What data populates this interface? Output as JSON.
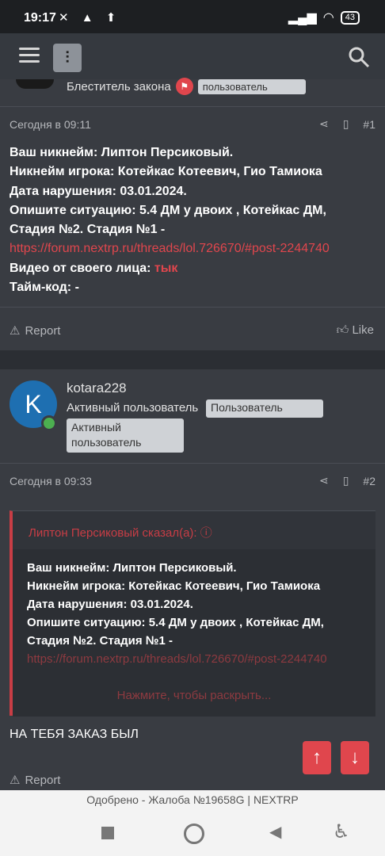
{
  "status": {
    "time": "19:17",
    "battery": "43"
  },
  "top_user": {
    "title": "Блеститель закона",
    "badge": "пользователь"
  },
  "post1": {
    "date": "Сегодня в 09:11",
    "number": "#1",
    "lines": [
      "Ваш никнейм: Липтон Персиковый.",
      "Никнейм игрока: Котейкас Котеевич, Гио Тамиока",
      "Дата нарушения: 03.01.2024.",
      "Опишите ситуацию: 5.4 ДМ у двоих , Котейкас ДМ,",
      "Стадия №2. Стадия №1 -"
    ],
    "link": "https://forum.nextrp.ru/threads/lol.726670/#post-2244740",
    "video_label": "Видео от своего лица: ",
    "video_link": "тык",
    "timecode": "Тайм-код: -",
    "report": "Report",
    "like": "Like"
  },
  "post2": {
    "avatar_letter": "K",
    "username": "kotara228",
    "user_title": "Активный пользователь",
    "badge1": "Пользователь",
    "badge2": "Активный пользователь",
    "date": "Сегодня в 09:33",
    "number": "#2",
    "quote_header": "Липтон Персиковый сказал(а):",
    "quote_lines": [
      "Ваш никнейм: Липтон Персиковый.",
      "Никнейм игрока: Котейкас Котеевич, Гио Тамиока",
      "Дата нарушения: 03.01.2024.",
      "Опишите ситуацию: 5.4 ДМ у двоих , Котейкас ДМ,",
      "Стадия №2. Стадия №1 -"
    ],
    "quote_link": "https://forum.nextrp.ru/threads/lol.726670/#post-2244740",
    "expand": "Нажмите, чтобы раскрыть...",
    "reply": "НА ТЕБЯ ЗАКАЗ БЫЛ",
    "report": "Report"
  },
  "bottom": {
    "title": "Одобрено - Жалоба №19658G | NEXTRP"
  },
  "icons": [
    "menu-icon",
    "search-icon",
    "share-icon",
    "bookmark-icon",
    "report-icon",
    "like-icon",
    "arrow-up-icon",
    "arrow-down-icon",
    "quote-arrow-icon"
  ]
}
